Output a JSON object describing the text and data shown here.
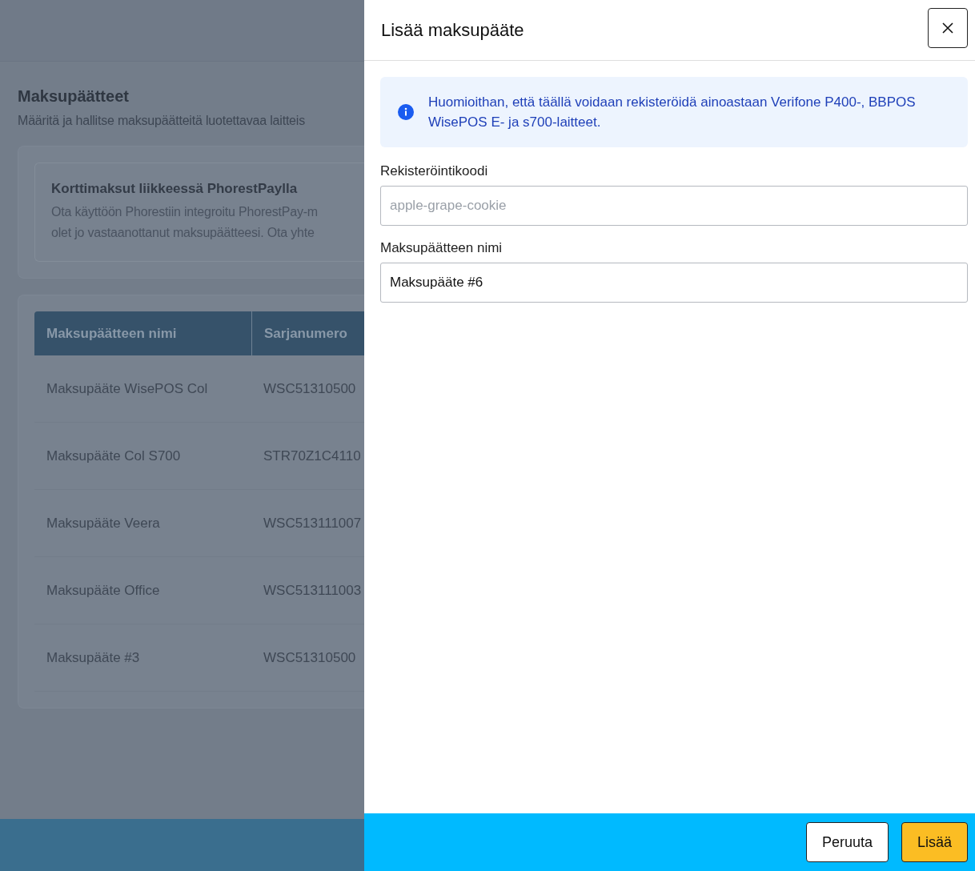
{
  "background_page": {
    "title": "Maksupäätteet",
    "subtitle": "Määritä ja hallitse maksupäätteitä luotettavaa laitteis",
    "promo": {
      "title": "Korttimaksut liikkeessä PhorestPaylla",
      "lines": [
        "Ota käyttöön Phorestiin integroitu PhorestPay-m",
        "olet jo vastaanottanut maksupäätteesi. Ota yhte"
      ]
    },
    "table": {
      "columns": [
        "Maksupäätteen nimi",
        "Sarjanumero"
      ],
      "rows": [
        [
          "Maksupääte WisePOS Col",
          "WSC51310500"
        ],
        [
          "Maksupääte Col S700",
          "STR70Z1C4110"
        ],
        [
          "Maksupääte Veera",
          "WSC513111007"
        ],
        [
          "Maksupääte Office",
          "WSC513111003"
        ],
        [
          "Maksupääte #3",
          "WSC51310500"
        ]
      ]
    }
  },
  "drawer": {
    "title": "Lisää maksupääte",
    "notice": "Huomioithan, että täällä voidaan rekisteröidä ainoastaan Verifone P400-, BBPOS WisePOS E- ja s700-laitteet.",
    "fields": [
      {
        "label": "Rekisteröintikoodi",
        "placeholder": "apple-grape-cookie"
      },
      {
        "label": "Maksupäätteen nimi",
        "value": "Maksupääte #6"
      }
    ],
    "buttons": [
      {
        "label": "Peruuta",
        "kind": "secondary"
      },
      {
        "label": "Lisää",
        "kind": "primary"
      }
    ]
  }
}
